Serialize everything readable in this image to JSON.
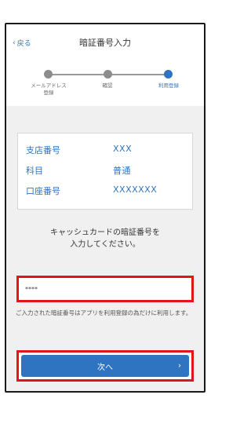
{
  "header": {
    "back_label": "戻る",
    "title": "暗証番号入力"
  },
  "steps": [
    {
      "label": "メールアドレス\n登録"
    },
    {
      "label": "確認"
    },
    {
      "label": "利用登録"
    }
  ],
  "account": {
    "rows": [
      {
        "label": "支店番号",
        "value": "XXX"
      },
      {
        "label": "科目",
        "value": "普通"
      },
      {
        "label": "口座番号",
        "value": "XXXXXXX"
      }
    ]
  },
  "instruction": {
    "line1": "キャッシュカードの暗証番号を",
    "line2": "入力してください。"
  },
  "pin_input": {
    "value": "****"
  },
  "note": "ご入力された暗証番号はアプリを利用登録の為だけに利用します。",
  "next_button": {
    "label": "次へ"
  },
  "colors": {
    "accent": "#2f74c0",
    "highlight": "#e0161c"
  }
}
